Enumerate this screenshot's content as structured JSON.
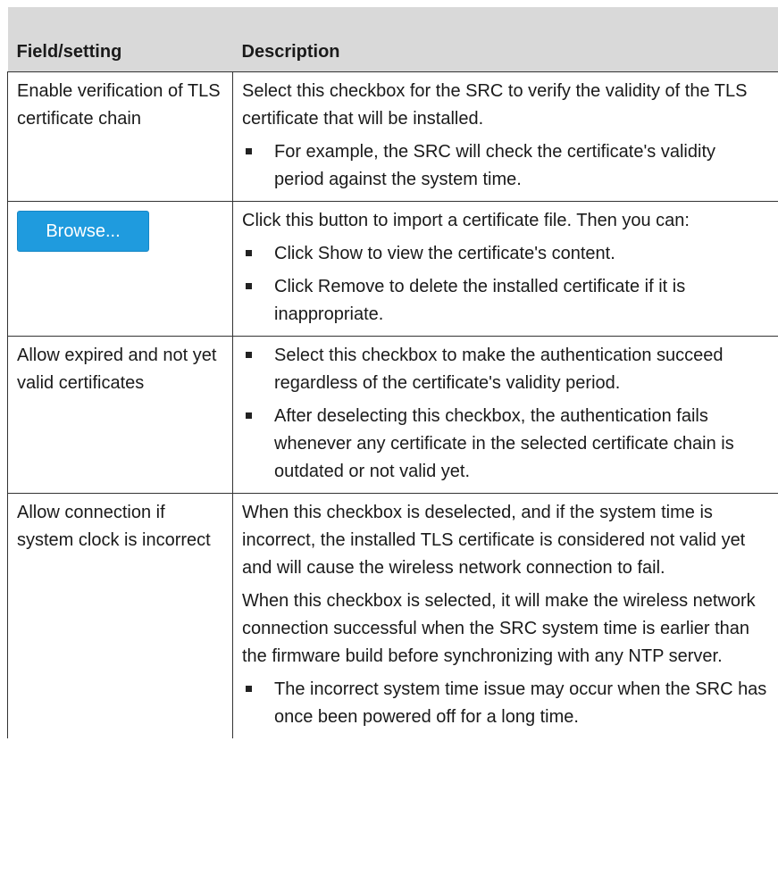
{
  "table": {
    "header": {
      "col1": "Field/setting",
      "col2": "Description"
    },
    "rows": [
      {
        "field": "Enable verification of TLS certificate chain",
        "paragraphs": [
          "Select this checkbox for the SRC to verify the validity of the TLS certificate that will be installed."
        ],
        "bullets": [
          "For example, the SRC will check the certificate's validity period against the system time."
        ]
      },
      {
        "button_label": "Browse...",
        "paragraphs": [
          "Click this button to import a certificate file. Then you can:"
        ],
        "bullets": [
          "Click Show to view the certificate's content.",
          "Click Remove to delete the installed certificate if it is inappropriate."
        ]
      },
      {
        "field": "Allow expired and not yet valid certificates",
        "bullets": [
          "Select this checkbox to make the authentication succeed regardless of the certificate's validity period.",
          "After deselecting this checkbox, the authentication fails whenever any certificate in the selected certificate chain is outdated or not valid yet."
        ]
      },
      {
        "field": "Allow connection if system clock is incorrect",
        "paragraphs": [
          "When this checkbox is deselected, and if the system time is incorrect, the installed TLS certificate is considered not valid yet and will cause the wireless network connection to fail.",
          "When this checkbox is selected, it will make the wireless network connection successful when the SRC system time is earlier than the firmware build before synchronizing with any NTP server."
        ],
        "bullets": [
          "The incorrect system time issue may occur when the SRC has once been powered off for a long time."
        ]
      }
    ]
  }
}
